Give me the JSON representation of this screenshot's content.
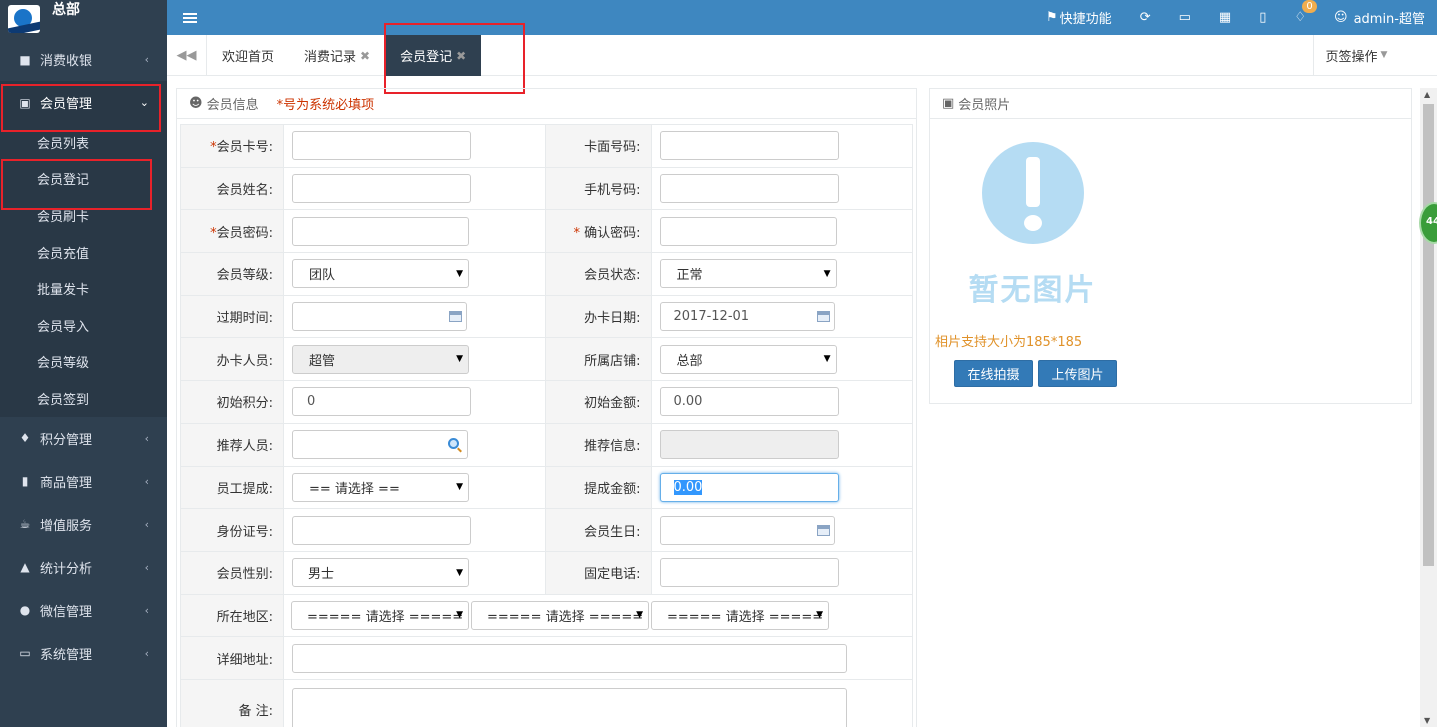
{
  "sidebar": {
    "brand": "总部",
    "menu": [
      {
        "label": "消费收银",
        "icon": "bag-icon"
      },
      {
        "label": "会员管理",
        "icon": "briefcase-icon"
      },
      {
        "label": "积分管理",
        "icon": "integral-icon"
      },
      {
        "label": "商品管理",
        "icon": "barcode-icon"
      },
      {
        "label": "增值服务",
        "icon": "coffee-icon"
      },
      {
        "label": "统计分析",
        "icon": "chart-icon"
      },
      {
        "label": "微信管理",
        "icon": "wechat-icon"
      },
      {
        "label": "系统管理",
        "icon": "desktop-icon"
      }
    ],
    "submenu": [
      "会员列表",
      "会员登记",
      "会员刷卡",
      "会员充值",
      "批量发卡",
      "会员导入",
      "会员等级",
      "会员签到"
    ]
  },
  "topbar": {
    "quick": "快捷功能",
    "badge": "0",
    "user": "admin-超管"
  },
  "tabs": {
    "items": [
      "欢迎首页",
      "消费记录",
      "会员登记"
    ],
    "ops": "页签操作"
  },
  "form": {
    "panel_title": "会员信息",
    "required_note": "*号为系统必填项",
    "star": "*",
    "labels": {
      "card_no": "会员卡号:",
      "face_no": "卡面号码:",
      "name": "会员姓名:",
      "phone": "手机号码:",
      "password": "会员密码:",
      "confirm": "确认密码:",
      "level": "会员等级:",
      "status": "会员状态:",
      "expire": "过期时间:",
      "issue_date": "办卡日期:",
      "issuer": "办卡人员:",
      "store": "所属店铺:",
      "init_points": "初始积分:",
      "init_amount": "初始金额:",
      "referrer": "推荐人员:",
      "ref_info": "推荐信息:",
      "commission": "员工提成:",
      "commission_amt": "提成金额:",
      "id_no": "身份证号:",
      "birthday": "会员生日:",
      "gender": "会员性别:",
      "tel": "固定电话:",
      "region": "所在地区:",
      "address": "详细地址:",
      "remark": "备 注:"
    },
    "values": {
      "level": "团队",
      "status": "正常",
      "issue_date": "2017-12-01",
      "issuer": "超管",
      "store": "总部",
      "init_points": "0",
      "init_amount": "0.00",
      "commission": "== 请选择 ==",
      "commission_amt": "0.00",
      "gender": "男士",
      "region1": "===== 请选择 =====",
      "region2": "===== 请选择 =====",
      "region3": "===== 请选择 ====="
    }
  },
  "photo": {
    "title": "会员照片",
    "placeholder": "暂无图片",
    "note": "相片支持大小为185*185",
    "btn_capture": "在线拍摄",
    "btn_upload": "上传图片"
  },
  "side_bubble": "44"
}
